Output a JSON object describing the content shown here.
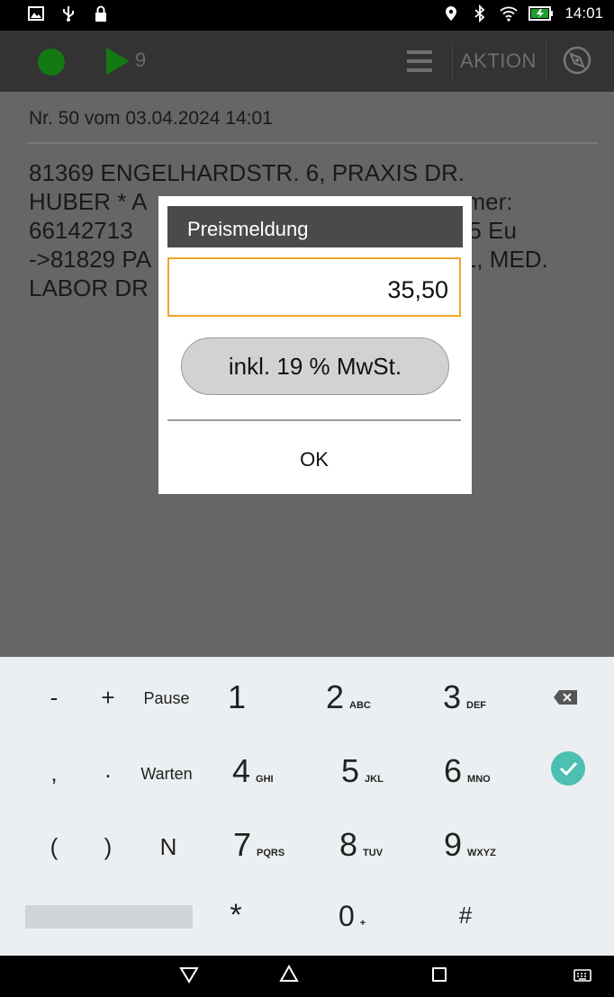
{
  "status_bar": {
    "time": "14:01"
  },
  "app_bar": {
    "play_count": "9",
    "action_label": "AKTION"
  },
  "content": {
    "order_line": "Nr. 50 vom 03.04.2024 14:01",
    "address": "81369 ENGELHARDSTR. 6, PRAXIS DR. HUBER * A                      nmer: 66142713                      lus 5 Eu ->81829 PA                       1, MED. LABOR DR"
  },
  "dialog": {
    "title": "Preismeldung",
    "price_value": "35,50",
    "vat_button": "inkl. 19 % MwSt.",
    "ok_button": "OK"
  },
  "keyboard": {
    "row1": {
      "minus": "-",
      "plus": "+",
      "pause": "Pause",
      "n1": "1",
      "n2": "2",
      "n2_sub": "ABC",
      "n3": "3",
      "n3_sub": "DEF"
    },
    "row2": {
      "comma": ",",
      "period": ".",
      "wait": "Warten",
      "n4": "4",
      "n4_sub": "GHI",
      "n5": "5",
      "n5_sub": "JKL",
      "n6": "6",
      "n6_sub": "MNO"
    },
    "row3": {
      "lparen": "(",
      "rparen": ")",
      "n_key": "N",
      "n7": "7",
      "n7_sub": "PQRS",
      "n8": "8",
      "n8_sub": "TUV",
      "n9": "9",
      "n9_sub": "WXYZ"
    },
    "row4": {
      "star": "*",
      "n0": "0",
      "n0_sub": "+",
      "hash": "#"
    }
  },
  "colors": {
    "accent_orange": "#f0a52a",
    "record_green": "#137a13",
    "done_teal": "#4dbfb0"
  },
  "icons": {
    "status_left": [
      "image-icon",
      "usb-icon",
      "lock-icon"
    ],
    "status_right": [
      "location-icon",
      "bluetooth-icon",
      "wifi-icon",
      "battery-charging-icon"
    ],
    "app_bar": [
      "record-icon",
      "play-icon",
      "menu-icon",
      "compass-icon"
    ],
    "keyboard": [
      "backspace-icon",
      "done-check-icon"
    ],
    "nav": [
      "back-icon",
      "home-icon",
      "recents-icon",
      "keyboard-icon"
    ]
  }
}
